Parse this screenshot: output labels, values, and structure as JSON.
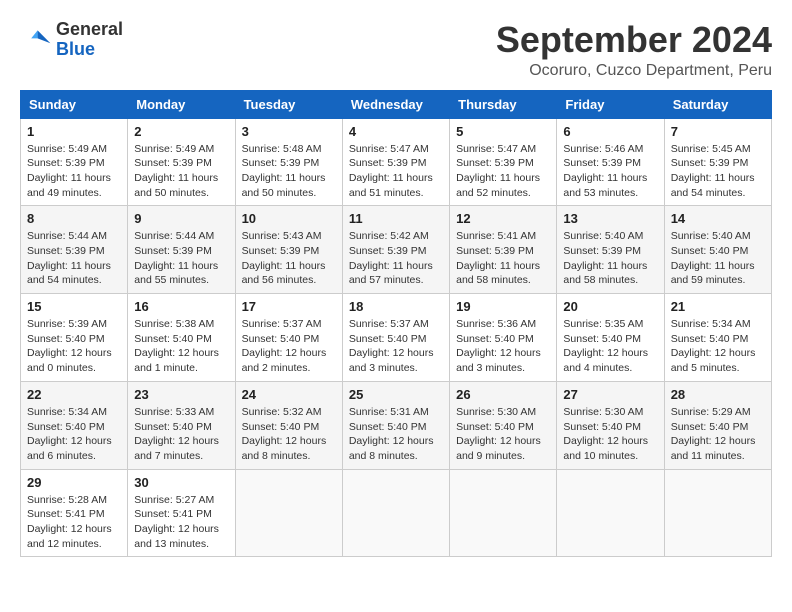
{
  "header": {
    "logo_line1": "General",
    "logo_line2": "Blue",
    "month_year": "September 2024",
    "location": "Ocoruro, Cuzco Department, Peru"
  },
  "days_of_week": [
    "Sunday",
    "Monday",
    "Tuesday",
    "Wednesday",
    "Thursday",
    "Friday",
    "Saturday"
  ],
  "weeks": [
    [
      {
        "day": "1",
        "sunrise": "5:49 AM",
        "sunset": "5:39 PM",
        "daylight": "11 hours and 49 minutes."
      },
      {
        "day": "2",
        "sunrise": "5:49 AM",
        "sunset": "5:39 PM",
        "daylight": "11 hours and 50 minutes."
      },
      {
        "day": "3",
        "sunrise": "5:48 AM",
        "sunset": "5:39 PM",
        "daylight": "11 hours and 50 minutes."
      },
      {
        "day": "4",
        "sunrise": "5:47 AM",
        "sunset": "5:39 PM",
        "daylight": "11 hours and 51 minutes."
      },
      {
        "day": "5",
        "sunrise": "5:47 AM",
        "sunset": "5:39 PM",
        "daylight": "11 hours and 52 minutes."
      },
      {
        "day": "6",
        "sunrise": "5:46 AM",
        "sunset": "5:39 PM",
        "daylight": "11 hours and 53 minutes."
      },
      {
        "day": "7",
        "sunrise": "5:45 AM",
        "sunset": "5:39 PM",
        "daylight": "11 hours and 54 minutes."
      }
    ],
    [
      {
        "day": "8",
        "sunrise": "5:44 AM",
        "sunset": "5:39 PM",
        "daylight": "11 hours and 54 minutes."
      },
      {
        "day": "9",
        "sunrise": "5:44 AM",
        "sunset": "5:39 PM",
        "daylight": "11 hours and 55 minutes."
      },
      {
        "day": "10",
        "sunrise": "5:43 AM",
        "sunset": "5:39 PM",
        "daylight": "11 hours and 56 minutes."
      },
      {
        "day": "11",
        "sunrise": "5:42 AM",
        "sunset": "5:39 PM",
        "daylight": "11 hours and 57 minutes."
      },
      {
        "day": "12",
        "sunrise": "5:41 AM",
        "sunset": "5:39 PM",
        "daylight": "11 hours and 58 minutes."
      },
      {
        "day": "13",
        "sunrise": "5:40 AM",
        "sunset": "5:39 PM",
        "daylight": "11 hours and 58 minutes."
      },
      {
        "day": "14",
        "sunrise": "5:40 AM",
        "sunset": "5:40 PM",
        "daylight": "11 hours and 59 minutes."
      }
    ],
    [
      {
        "day": "15",
        "sunrise": "5:39 AM",
        "sunset": "5:40 PM",
        "daylight": "12 hours and 0 minutes."
      },
      {
        "day": "16",
        "sunrise": "5:38 AM",
        "sunset": "5:40 PM",
        "daylight": "12 hours and 1 minute."
      },
      {
        "day": "17",
        "sunrise": "5:37 AM",
        "sunset": "5:40 PM",
        "daylight": "12 hours and 2 minutes."
      },
      {
        "day": "18",
        "sunrise": "5:37 AM",
        "sunset": "5:40 PM",
        "daylight": "12 hours and 3 minutes."
      },
      {
        "day": "19",
        "sunrise": "5:36 AM",
        "sunset": "5:40 PM",
        "daylight": "12 hours and 3 minutes."
      },
      {
        "day": "20",
        "sunrise": "5:35 AM",
        "sunset": "5:40 PM",
        "daylight": "12 hours and 4 minutes."
      },
      {
        "day": "21",
        "sunrise": "5:34 AM",
        "sunset": "5:40 PM",
        "daylight": "12 hours and 5 minutes."
      }
    ],
    [
      {
        "day": "22",
        "sunrise": "5:34 AM",
        "sunset": "5:40 PM",
        "daylight": "12 hours and 6 minutes."
      },
      {
        "day": "23",
        "sunrise": "5:33 AM",
        "sunset": "5:40 PM",
        "daylight": "12 hours and 7 minutes."
      },
      {
        "day": "24",
        "sunrise": "5:32 AM",
        "sunset": "5:40 PM",
        "daylight": "12 hours and 8 minutes."
      },
      {
        "day": "25",
        "sunrise": "5:31 AM",
        "sunset": "5:40 PM",
        "daylight": "12 hours and 8 minutes."
      },
      {
        "day": "26",
        "sunrise": "5:30 AM",
        "sunset": "5:40 PM",
        "daylight": "12 hours and 9 minutes."
      },
      {
        "day": "27",
        "sunrise": "5:30 AM",
        "sunset": "5:40 PM",
        "daylight": "12 hours and 10 minutes."
      },
      {
        "day": "28",
        "sunrise": "5:29 AM",
        "sunset": "5:40 PM",
        "daylight": "12 hours and 11 minutes."
      }
    ],
    [
      {
        "day": "29",
        "sunrise": "5:28 AM",
        "sunset": "5:41 PM",
        "daylight": "12 hours and 12 minutes."
      },
      {
        "day": "30",
        "sunrise": "5:27 AM",
        "sunset": "5:41 PM",
        "daylight": "12 hours and 13 minutes."
      },
      null,
      null,
      null,
      null,
      null
    ]
  ],
  "labels": {
    "sunrise": "Sunrise:",
    "sunset": "Sunset:",
    "daylight": "Daylight:"
  },
  "accent_color": "#1565c0"
}
